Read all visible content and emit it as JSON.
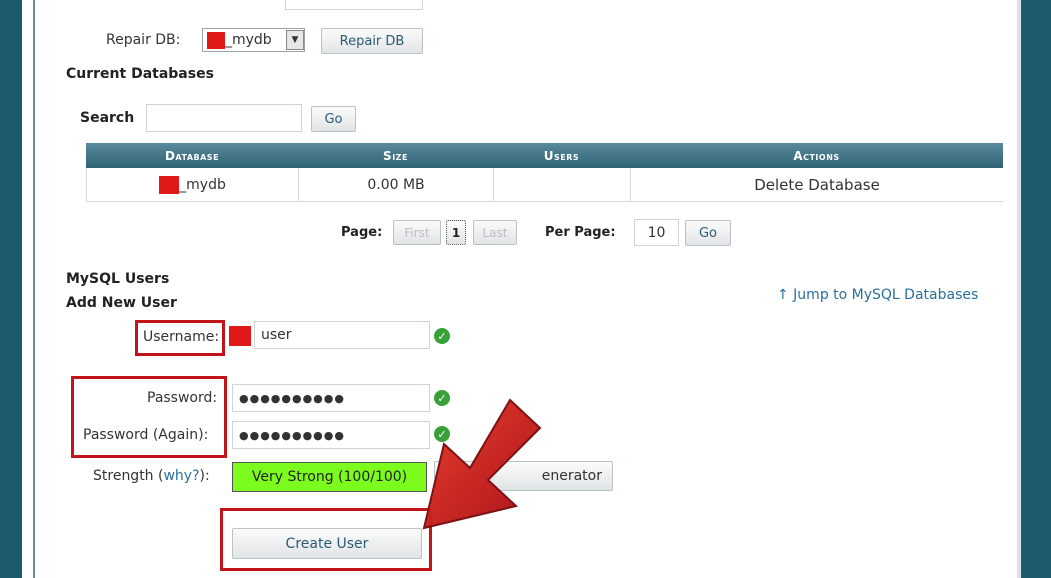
{
  "repair": {
    "label": "Repair DB:",
    "selected": "_mydb",
    "button": "Repair DB"
  },
  "current_databases": {
    "heading": "Current Databases",
    "search_label": "Search",
    "search_value": "",
    "go": "Go"
  },
  "table": {
    "headers": [
      "Database",
      "Size",
      "Users",
      "Actions"
    ],
    "rows": [
      {
        "database": "_mydb",
        "size": "0.00 MB",
        "users": "",
        "action": "Delete Database"
      }
    ]
  },
  "pagination": {
    "page_label": "Page:",
    "first": "First",
    "current": "1",
    "last": "Last",
    "per_page_label": "Per Page:",
    "per_page_value": "10",
    "go": "Go"
  },
  "mysql_users": {
    "heading": "MySQL Users",
    "add_new_user": "Add New User",
    "jump_link": "↑ Jump to MySQL Databases"
  },
  "form": {
    "username_label": "Username:",
    "username_value": "user",
    "password_label": "Password:",
    "password_value": "●●●●●●●●●●",
    "password_again_label": "Password (Again):",
    "password_again_value": "●●●●●●●●●●",
    "strength_label": "Strength (",
    "strength_link": "why?",
    "strength_tail": "):",
    "strength_value": "Very Strong (100/100)",
    "generator_label": "enerator",
    "create_user": "Create User"
  },
  "colors": {
    "accent": "#1c5a6c",
    "strength": "#7cfc1c",
    "highlight": "#c0141a",
    "check": "#3aa13a"
  }
}
